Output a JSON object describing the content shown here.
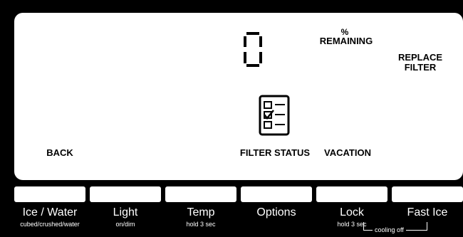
{
  "display": {
    "digit": "0",
    "percent_sign": "%",
    "remaining_label": "REMAINING",
    "replace_filter_line1": "REPLACE",
    "replace_filter_line2": "FILTER",
    "back_label": "BACK",
    "filter_status_label": "FILTER STATUS",
    "vacation_label": "VACATION"
  },
  "icons": {
    "filter_status": "checklist-icon"
  },
  "buttons": [
    {
      "label": "Ice / Water",
      "sub": "cubed/crushed/water"
    },
    {
      "label": "Light",
      "sub": "on/dim"
    },
    {
      "label": "Temp",
      "sub": "hold 3 sec"
    },
    {
      "label": "Options",
      "sub": ""
    },
    {
      "label": "Lock",
      "sub": "hold 3 sec"
    },
    {
      "label": "Fast Ice",
      "sub": ""
    }
  ],
  "cooling_off_label": "cooling off",
  "colors": {
    "background": "#000000",
    "panel": "#ffffff"
  }
}
